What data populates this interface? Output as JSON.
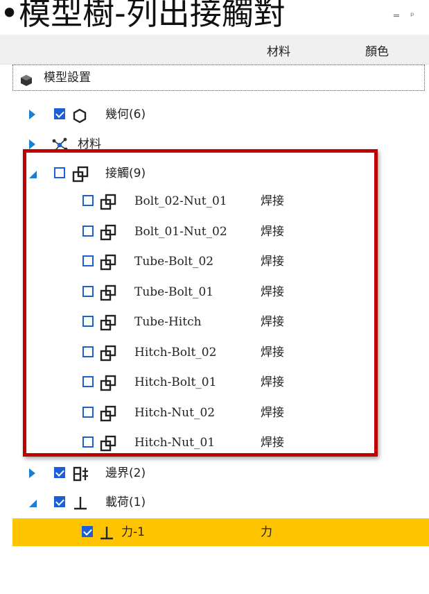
{
  "slide_title": "•模型樹-列出接觸對",
  "pane_controls": "═ ᵖ",
  "header": {
    "col_material": "材料",
    "col_color": "顏色"
  },
  "root": {
    "label": "模型設置"
  },
  "items": [
    {
      "label": "幾何(6)",
      "state": "collapsed",
      "checked": true,
      "icon": "hexagon-icon"
    },
    {
      "label": "材料",
      "state": "collapsed",
      "icon": "material-icon"
    },
    {
      "label": "接觸(9)",
      "state": "expanded",
      "checked": false,
      "icon": "contact-icon"
    }
  ],
  "contacts": [
    {
      "name": "Bolt_02-Nut_01",
      "material": "焊接"
    },
    {
      "name": "Bolt_01-Nut_02",
      "material": "焊接"
    },
    {
      "name": "Tube-Bolt_02",
      "material": "焊接"
    },
    {
      "name": "Tube-Bolt_01",
      "material": "焊接"
    },
    {
      "name": "Tube-Hitch",
      "material": "焊接"
    },
    {
      "name": "Hitch-Bolt_02",
      "material": "焊接"
    },
    {
      "name": "Hitch-Bolt_01",
      "material": "焊接"
    },
    {
      "name": "Hitch-Nut_02",
      "material": "焊接"
    },
    {
      "name": "Hitch-Nut_01",
      "material": "焊接"
    }
  ],
  "boundary": {
    "label": "邊界(2)",
    "checked": true
  },
  "loads": {
    "label": "載荷(1)",
    "checked": true
  },
  "force": {
    "label": "力-1",
    "material": "力",
    "checked": true
  },
  "colors": {
    "accent": "#1b5fd6",
    "selected": "#ffc400",
    "highlight": "#c00000"
  }
}
